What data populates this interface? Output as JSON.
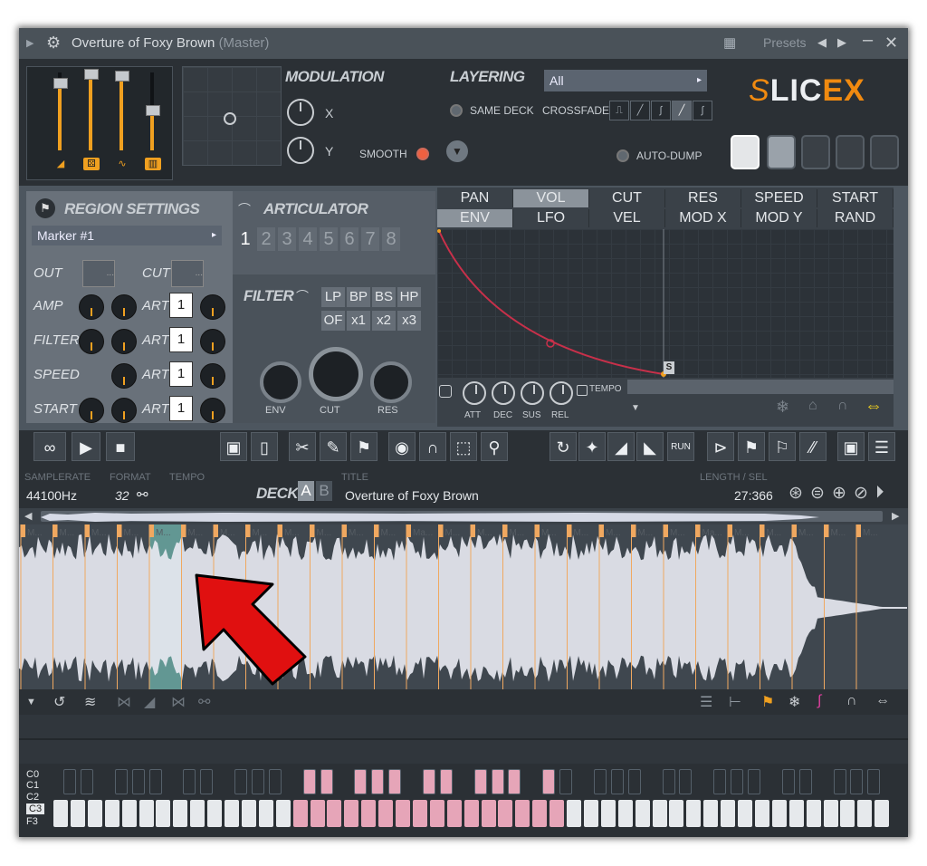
{
  "window": {
    "title": "Overture of Foxy Brown",
    "title_suffix": "(Master)",
    "presets_label": "Presets"
  },
  "modulation": {
    "title": "MODULATION",
    "x_label": "X",
    "y_label": "Y",
    "smooth_label": "SMOOTH"
  },
  "layering": {
    "title": "LAYERING",
    "select_value": "All",
    "same_deck_label": "SAME DECK",
    "crossfade_label": "CROSSFADE",
    "auto_dump_label": "AUTO-DUMP"
  },
  "logo": {
    "prefix": "S",
    "text_a": "LIC",
    "text_b": "EX",
    "accent_color": "#f08a10"
  },
  "region": {
    "title": "REGION SETTINGS",
    "marker_value": "Marker #1",
    "out_label": "OUT",
    "cut_label": "CUT",
    "rows": [
      {
        "label": "AMP",
        "art_label": "ART",
        "art_value": "1"
      },
      {
        "label": "FILTER",
        "art_label": "ART",
        "art_value": "1"
      },
      {
        "label": "SPEED",
        "art_label": "ART",
        "art_value": "1"
      },
      {
        "label": "START",
        "art_label": "ART",
        "art_value": "1"
      }
    ],
    "box_placeholder": "..."
  },
  "articulator": {
    "title": "ARTICULATOR",
    "numbers": [
      "1",
      "2",
      "3",
      "4",
      "5",
      "6",
      "7",
      "8"
    ],
    "selected": "1"
  },
  "filter": {
    "title": "FILTER",
    "types": [
      "LP",
      "BP",
      "BS",
      "HP"
    ],
    "order": [
      "OF",
      "x1",
      "x2",
      "x3"
    ],
    "knob_labels": [
      "ENV",
      "CUT",
      "RES"
    ]
  },
  "envelope": {
    "tabs_row1": [
      "PAN",
      "VOL",
      "CUT",
      "RES",
      "SPEED",
      "START"
    ],
    "tabs_row2": [
      "ENV",
      "LFO",
      "VEL",
      "MOD X",
      "MOD Y",
      "RAND"
    ],
    "selected_row1": "VOL",
    "selected_row2": "ENV",
    "knob_labels": [
      "ATT",
      "DEC",
      "SUS",
      "REL"
    ],
    "tempo_label": "TEMPO",
    "curve_color": "#c8304a",
    "sustain_marker": "S"
  },
  "info": {
    "samplerate_caption": "SAMPLERATE",
    "samplerate_value": "44100Hz",
    "format_caption": "FORMAT",
    "format_value": "32",
    "tempo_caption": "TEMPO",
    "deck_label": "DECK",
    "deck_a": "A",
    "deck_b": "B",
    "title_caption": "TITLE",
    "title_value": "Overture of Foxy Brown",
    "length_caption": "LENGTH / SEL",
    "length_value": "27:366"
  },
  "waveform": {
    "marker_labels": [
      "M...",
      "M...",
      "M...",
      "M...",
      "M...",
      "M...",
      "M...",
      "M...",
      "M...",
      "M...",
      "M...",
      "M...",
      "Ma...",
      "M...",
      "M...",
      "M...",
      "M...",
      "M...",
      "M...",
      "M...",
      "M...",
      "Ma...",
      "M...",
      "M...",
      "M...",
      "M...",
      "M..."
    ],
    "selected_region_index": 4,
    "selection_color": "#7fd8cc",
    "marker_color": "#f0a860"
  },
  "annotation": {
    "arrow_color": "#e01010"
  },
  "keyboard": {
    "labels": [
      "C0",
      "C1",
      "C2",
      "C3",
      "F3"
    ],
    "highlight_color": "#e6a5b8"
  }
}
